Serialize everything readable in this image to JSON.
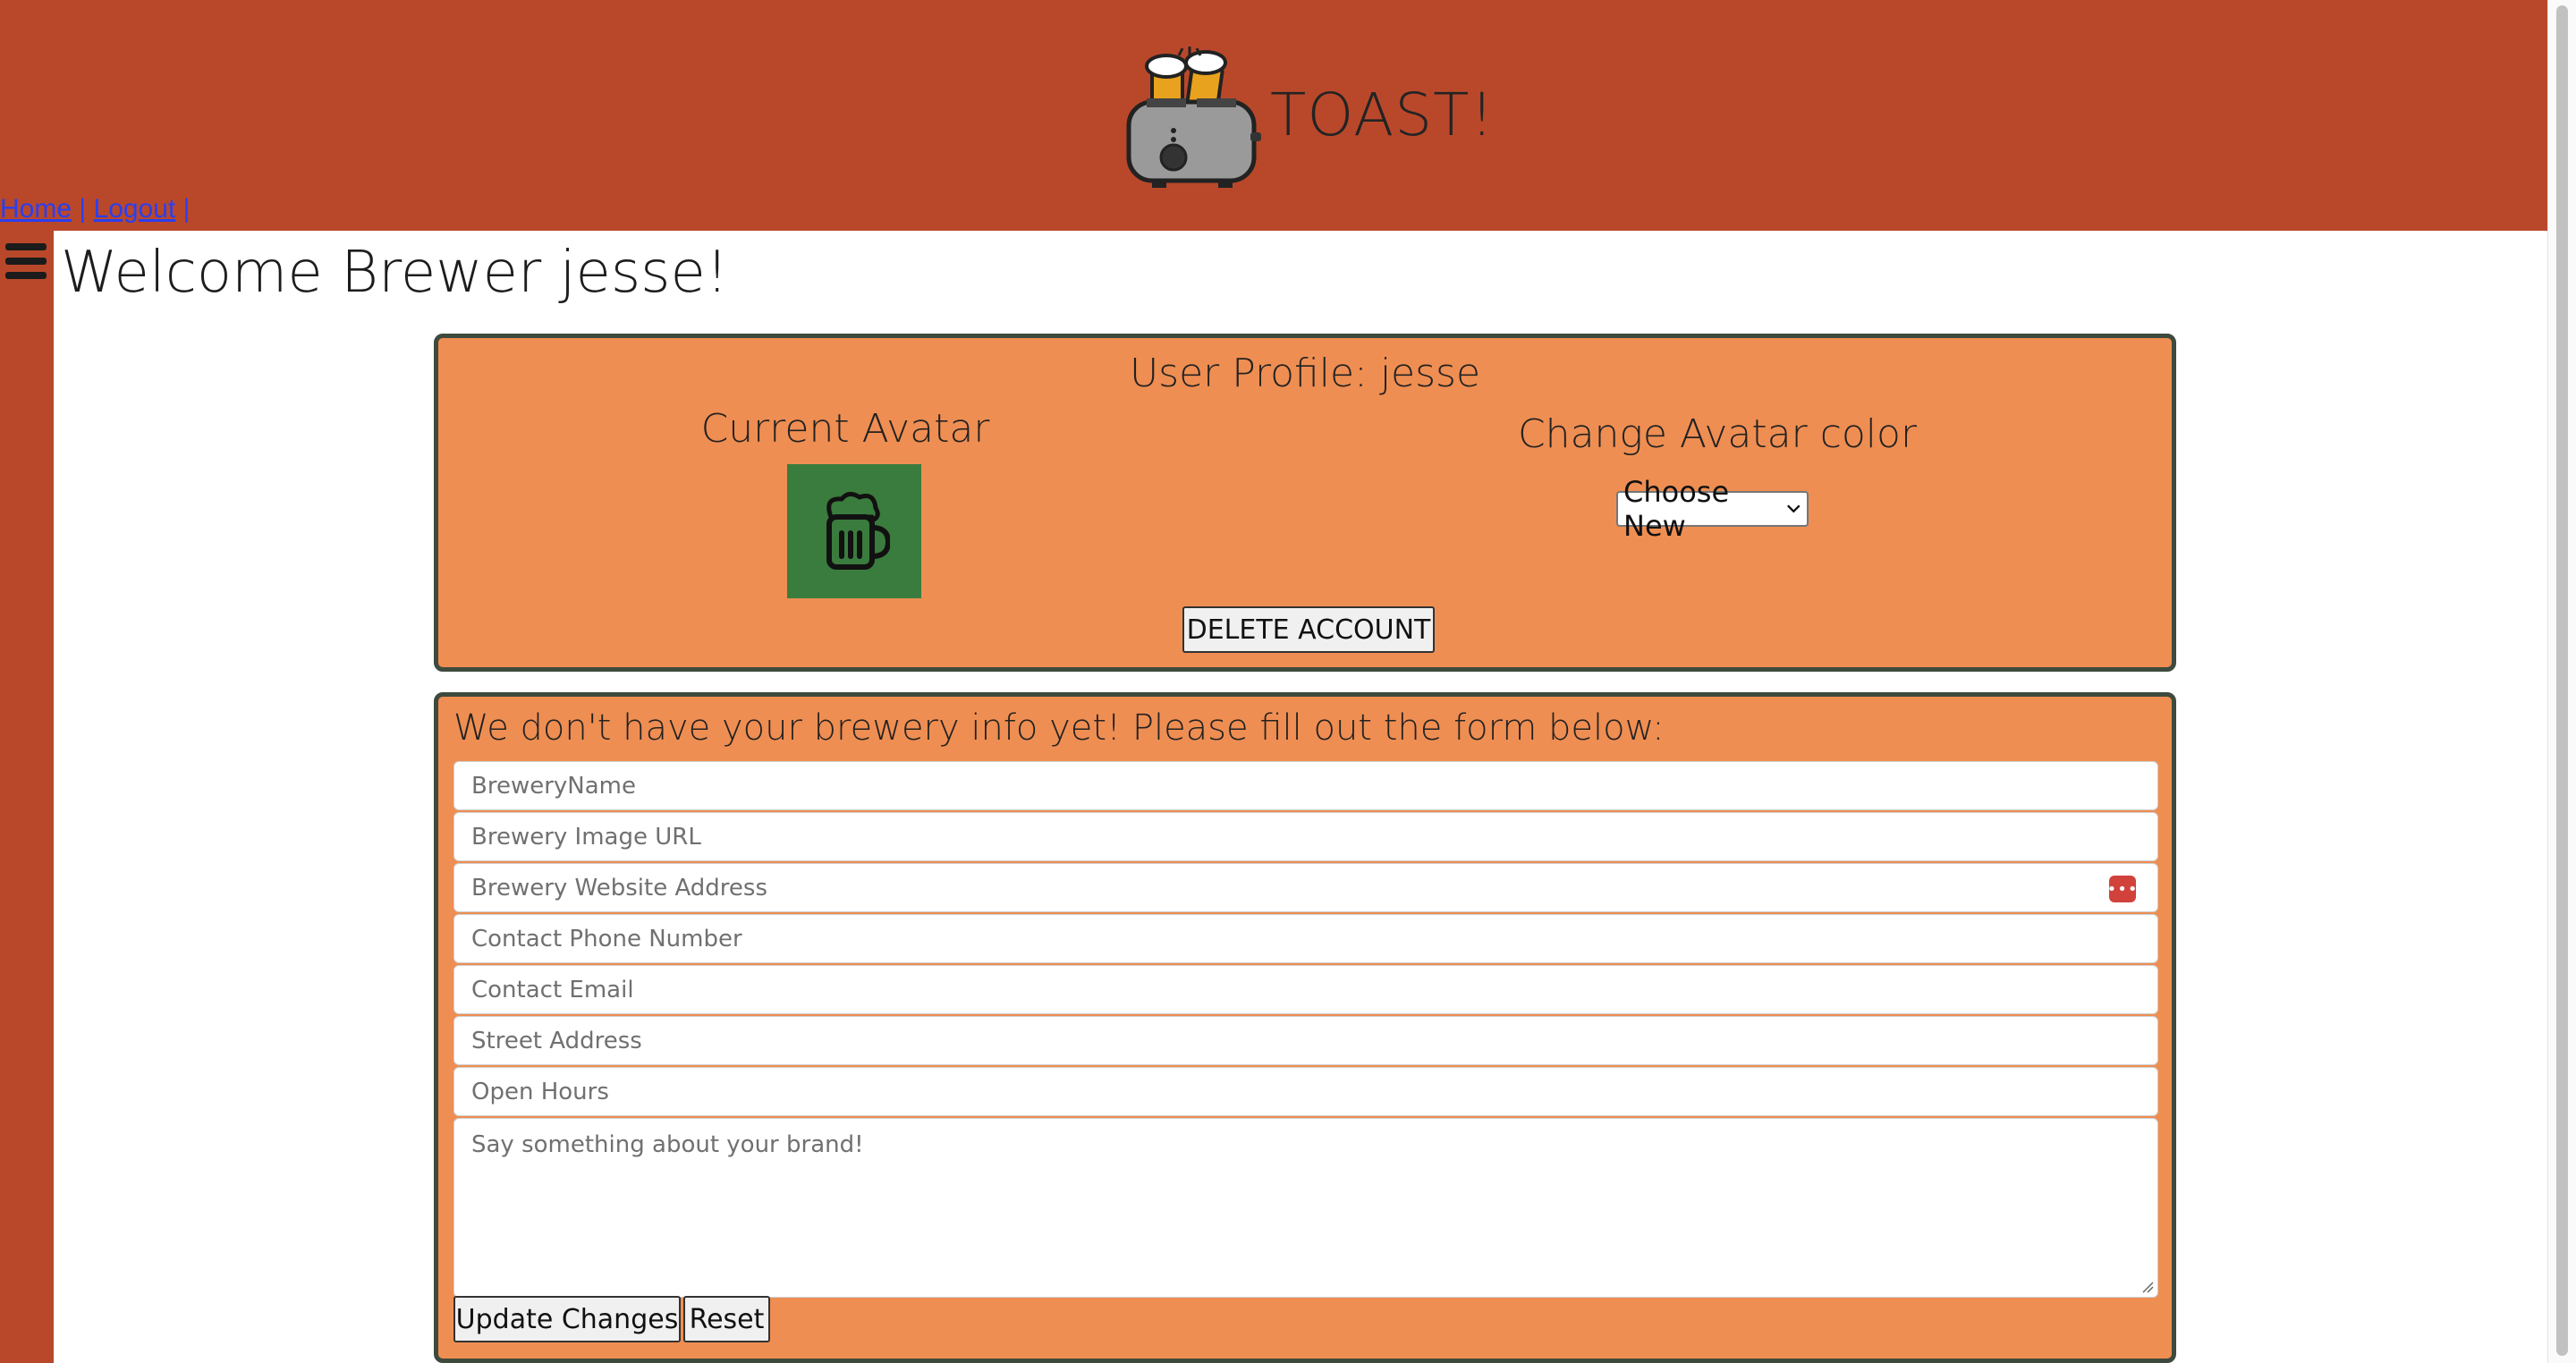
{
  "header": {
    "brand": "TOAST!",
    "nav": {
      "home": "Home",
      "sep1": "|",
      "logout": "Logout",
      "sep2": "|"
    }
  },
  "welcome": "Welcome Brewer jesse!",
  "profile": {
    "title": "User Profile: jesse",
    "current_avatar_label": "Current Avatar",
    "avatar_color": "#3a7c3d",
    "change_color_label": "Change Avatar color",
    "color_select_value": "Choose New",
    "delete_label": "DELETE ACCOUNT"
  },
  "brewery": {
    "message": "We don't have your brewery info yet! Please fill out the form below:",
    "fields": {
      "name": "BreweryName",
      "image_url": "Brewery Image URL",
      "website": "Brewery Website Address",
      "phone": "Contact Phone Number",
      "email": "Contact Email",
      "street": "Street Address",
      "hours": "Open Hours",
      "about": "Say something about your brand!"
    },
    "update_label": "Update Changes",
    "reset_label": "Reset"
  },
  "colors": {
    "header": "#b9482a",
    "panel": "#ef8e52",
    "panel_border": "#3d4a3d"
  }
}
